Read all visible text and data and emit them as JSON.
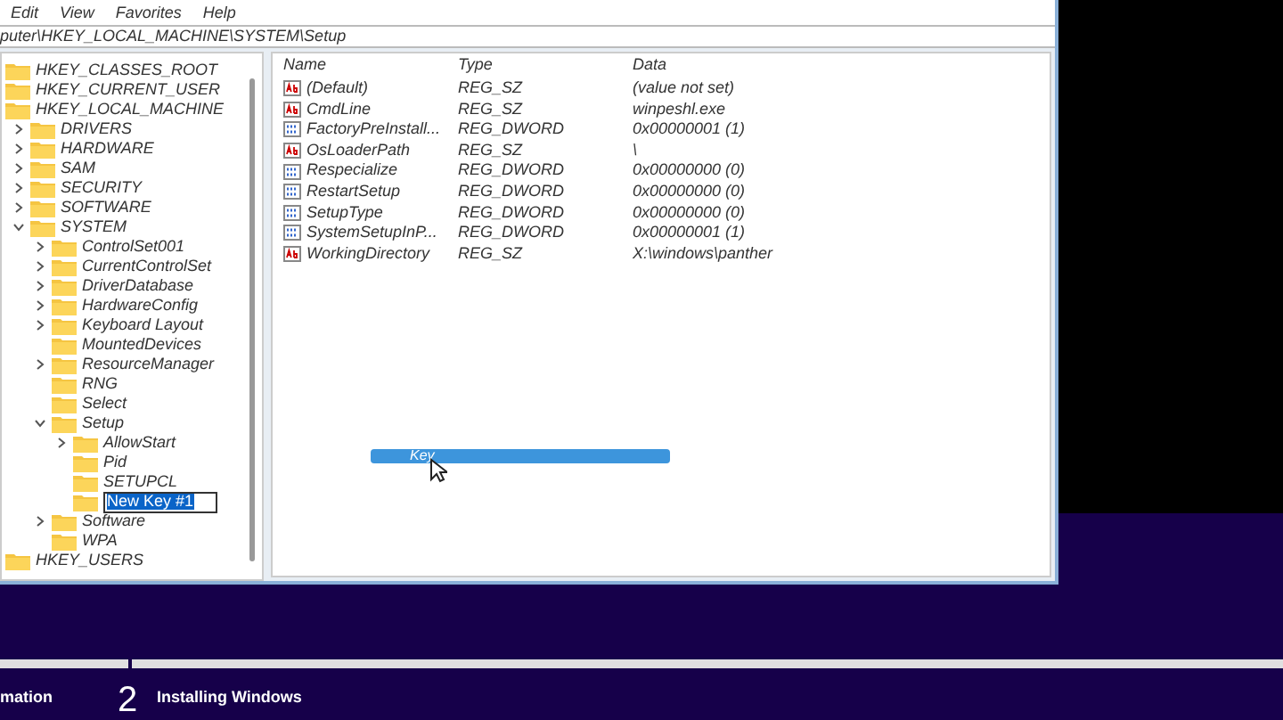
{
  "menu": [
    "Edit",
    "View",
    "Favorites",
    "Help"
  ],
  "address": "puter\\HKEY_LOCAL_MACHINE\\SYSTEM\\Setup",
  "tree": [
    {
      "label": "HKEY_CLASSES_ROOT"
    },
    {
      "label": "HKEY_CURRENT_USER"
    },
    {
      "label": "HKEY_LOCAL_MACHINE",
      "children": [
        {
          "label": "DRIVERS",
          "expanded": false
        },
        {
          "label": "HARDWARE",
          "expanded": false
        },
        {
          "label": "SAM",
          "expanded": false
        },
        {
          "label": "SECURITY",
          "expanded": false
        },
        {
          "label": "SOFTWARE",
          "expanded": false
        },
        {
          "label": "SYSTEM",
          "expanded": true,
          "children": [
            {
              "label": "ControlSet001",
              "expanded": false
            },
            {
              "label": "CurrentControlSet",
              "expanded": false
            },
            {
              "label": "DriverDatabase",
              "expanded": false
            },
            {
              "label": "HardwareConfig",
              "expanded": false
            },
            {
              "label": "Keyboard Layout",
              "expanded": false
            },
            {
              "label": "MountedDevices"
            },
            {
              "label": "ResourceManager",
              "expanded": false
            },
            {
              "label": "RNG"
            },
            {
              "label": "Select"
            },
            {
              "label": "Setup",
              "expanded": true,
              "children": [
                {
                  "label": "AllowStart",
                  "expanded": false
                },
                {
                  "label": "Pid"
                },
                {
                  "label": "SETUPCL"
                },
                {
                  "label": "New Key #1",
                  "kind": "edit"
                }
              ]
            },
            {
              "label": "Software",
              "expanded": false
            },
            {
              "label": "WPA"
            }
          ]
        }
      ]
    },
    {
      "label": "HKEY_USERS"
    }
  ],
  "columns": [
    "Name",
    "Type",
    "Data"
  ],
  "values": [
    {
      "kind": "string",
      "name": "(Default)",
      "type": "REG_SZ",
      "data": "(value not set)"
    },
    {
      "kind": "string",
      "name": "CmdLine",
      "type": "REG_SZ",
      "data": "winpeshl.exe"
    },
    {
      "kind": "binary",
      "name": "FactoryPreInstall...",
      "type": "REG_DWORD",
      "data": "0x00000001 (1)"
    },
    {
      "kind": "string",
      "name": "OsLoaderPath",
      "type": "REG_SZ",
      "data": "\\"
    },
    {
      "kind": "binary",
      "name": "Respecialize",
      "type": "REG_DWORD",
      "data": "0x00000000 (0)"
    },
    {
      "kind": "binary",
      "name": "RestartSetup",
      "type": "REG_DWORD",
      "data": "0x00000000 (0)"
    },
    {
      "kind": "binary",
      "name": "SetupType",
      "type": "REG_DWORD",
      "data": "0x00000000 (0)"
    },
    {
      "kind": "binary",
      "name": "SystemSetupInP...",
      "type": "REG_DWORD",
      "data": "0x00000001 (1)"
    },
    {
      "kind": "string",
      "name": "WorkingDirectory",
      "type": "REG_SZ",
      "data": "X:\\windows\\panther"
    }
  ],
  "drag_item": "Key",
  "setup_steps": [
    {
      "label": "mation"
    },
    {
      "number": "2",
      "label": "Installing Windows"
    }
  ]
}
